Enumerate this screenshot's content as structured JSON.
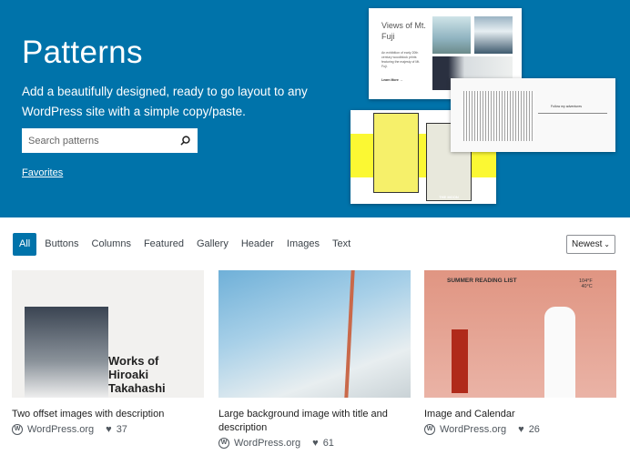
{
  "hero": {
    "title": "Patterns",
    "subtitle": "Add a beautifully designed, ready to go layout to any WordPress site with a simple copy/paste.",
    "search_placeholder": "Search patterns",
    "favorites": "Favorites"
  },
  "previews": {
    "fuji_title": "Views of Mt. Fuji",
    "fuji_desc": "An exhibition of early 20th century woodblock prints featuring the majesty of Mt. Fuji.",
    "fuji_link": "Learn More →",
    "follow": "Follow my adventures",
    "moon": "THE MOON"
  },
  "filters": [
    "All",
    "Buttons",
    "Columns",
    "Featured",
    "Gallery",
    "Header",
    "Images",
    "Text"
  ],
  "sort": {
    "selected": "Newest"
  },
  "cards": [
    {
      "title": "Two offset images with description",
      "author": "WordPress.org",
      "likes": "37",
      "thumb_text": "Works of Hiroaki Takahashi"
    },
    {
      "title": "Large background image with title and description",
      "author": "WordPress.org",
      "likes": "61"
    },
    {
      "title": "Image and Calendar",
      "author": "WordPress.org",
      "likes": "26",
      "thumb_text": "SUMMER READING LIST",
      "temp_f": "104°F",
      "temp_c": "40°C"
    }
  ],
  "colors": {
    "brand": "#0073aa"
  }
}
